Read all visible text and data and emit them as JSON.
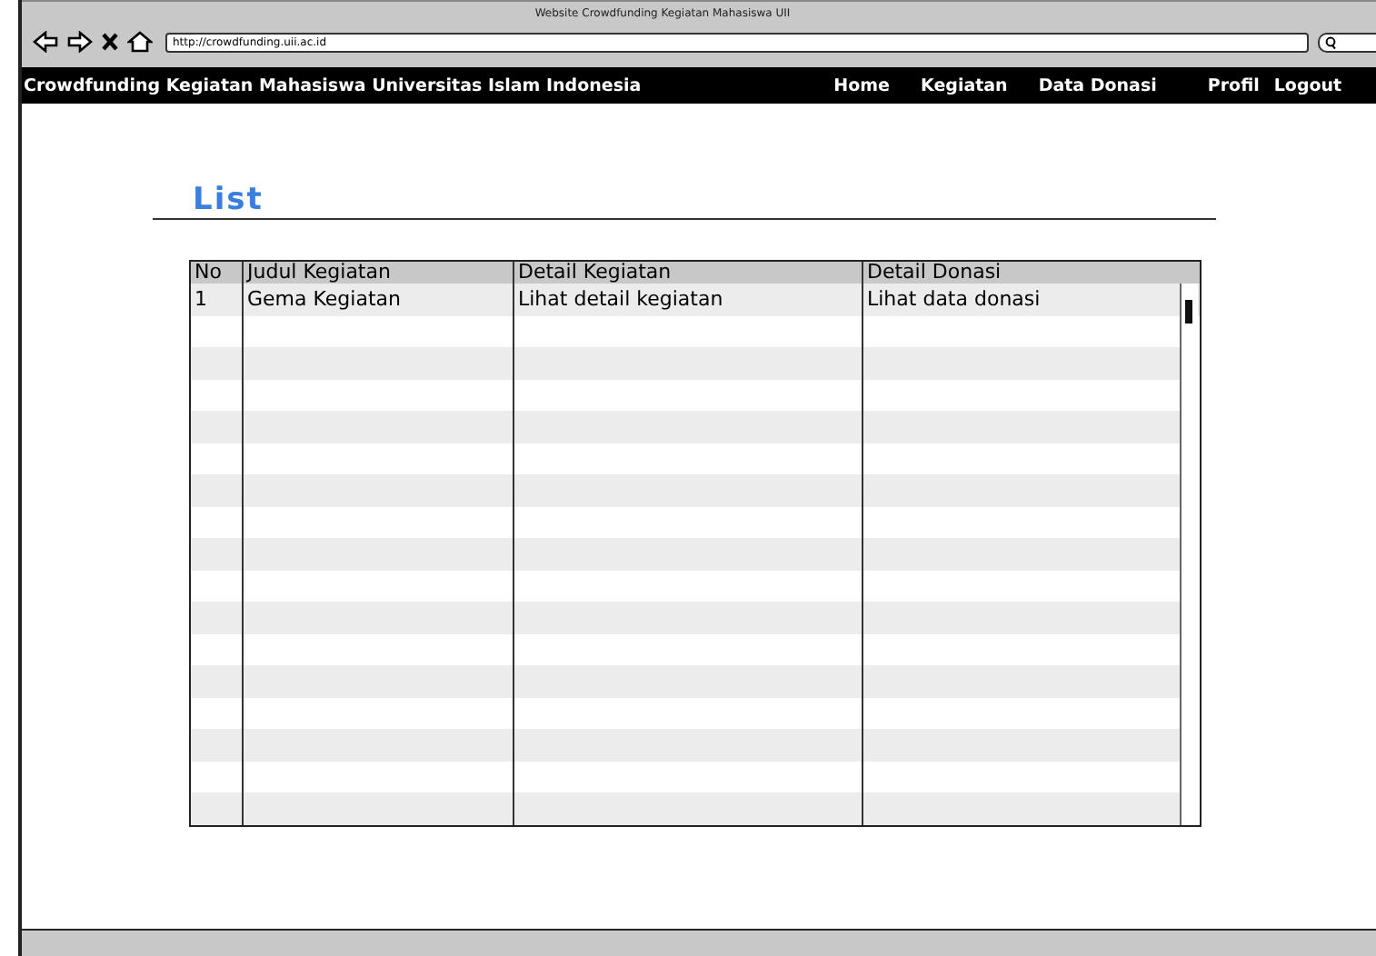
{
  "window": {
    "title": "Website Crowdfunding Kegiatan Mahasiswa UII",
    "url": "http://crowdfunding.uii.ac.id"
  },
  "navbar": {
    "brand": "Crowdfunding Kegiatan Mahasiswa Universitas Islam Indonesia",
    "items": [
      "Home",
      "Kegiatan",
      "Data Donasi",
      "Profil",
      "Logout"
    ]
  },
  "heading": "List",
  "table": {
    "columns": [
      "No",
      "Judul Kegiatan",
      "Detail Kegiatan",
      "Detail Donasi"
    ],
    "rows": [
      [
        "1",
        "Gema Kegiatan",
        "Lihat detail kegiatan",
        "Lihat data donasi"
      ]
    ]
  }
}
